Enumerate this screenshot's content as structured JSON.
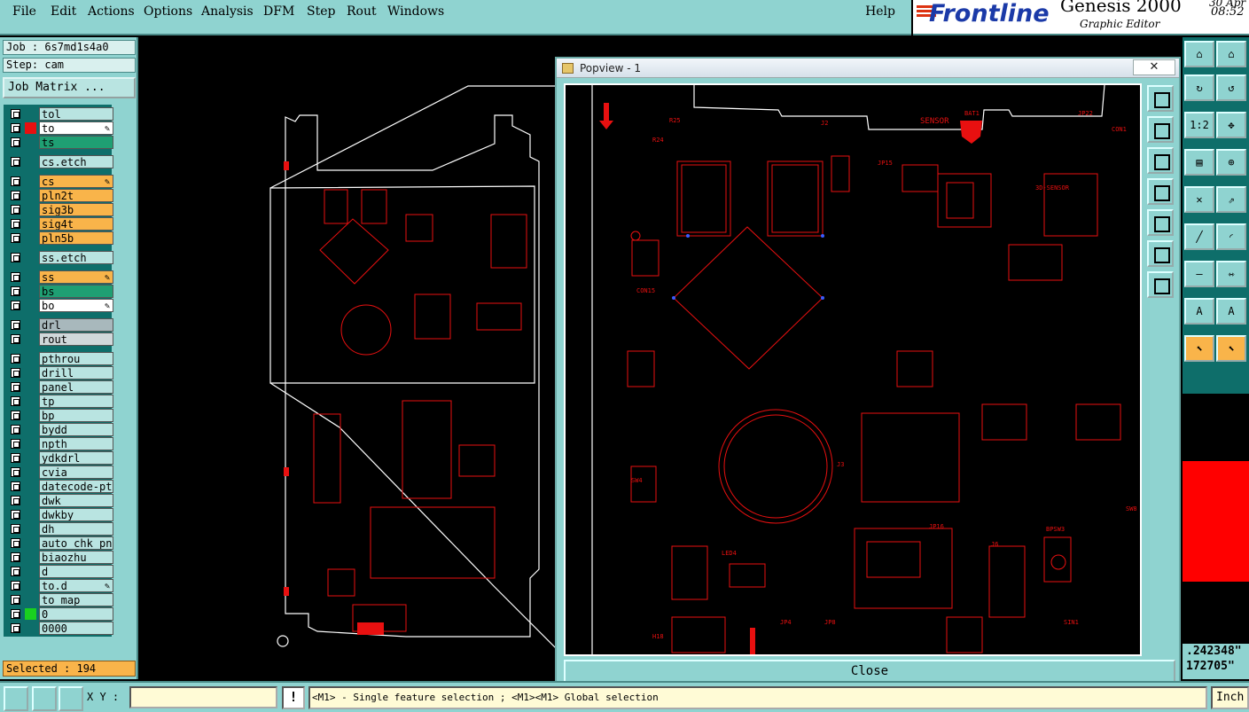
{
  "menu": {
    "items": [
      "File",
      "Edit",
      "Actions",
      "Options",
      "Analysis",
      "DFM",
      "Step",
      "Rout",
      "Windows"
    ],
    "help": "Help"
  },
  "brand": {
    "name": "Frontline",
    "product": "Genesis 2000",
    "subtitle": "Graphic Editor",
    "date": "30 Apr",
    "time": "08:52"
  },
  "job": {
    "job_label": "Job : 6s7md1s4a0",
    "step_label": "Step: cam",
    "matrix_button": "Job Matrix ..."
  },
  "layers": [
    {
      "name": "tol",
      "color": "#b9e4e1",
      "edit": false,
      "mark": ""
    },
    {
      "name": "to",
      "color": "#ffffff",
      "edit": true,
      "mark": "#e81010"
    },
    {
      "name": "ts",
      "color": "#1f9f73",
      "edit": false,
      "mark": ""
    },
    {
      "name": "cs.etch",
      "color": "#b9e4e1",
      "edit": false,
      "mark": ""
    },
    {
      "name": "cs",
      "color": "#f9b44a",
      "edit": true,
      "mark": ""
    },
    {
      "name": "pln2t",
      "color": "#f9b44a",
      "edit": false,
      "mark": ""
    },
    {
      "name": "sig3b",
      "color": "#f9b44a",
      "edit": false,
      "mark": ""
    },
    {
      "name": "sig4t",
      "color": "#f9b44a",
      "edit": false,
      "mark": ""
    },
    {
      "name": "pln5b",
      "color": "#f9b44a",
      "edit": false,
      "mark": ""
    },
    {
      "name": "ss.etch",
      "color": "#b9e4e1",
      "edit": false,
      "mark": ""
    },
    {
      "name": "ss",
      "color": "#f9b44a",
      "edit": true,
      "mark": ""
    },
    {
      "name": "bs",
      "color": "#1f9f73",
      "edit": false,
      "mark": ""
    },
    {
      "name": "bo",
      "color": "#ffffff",
      "edit": true,
      "mark": ""
    },
    {
      "name": "drl",
      "color": "#a8b8bc",
      "edit": false,
      "mark": ""
    },
    {
      "name": "rout",
      "color": "#d0d8da",
      "edit": false,
      "mark": ""
    },
    {
      "name": "pthrou",
      "color": "#b9e4e1",
      "edit": false,
      "mark": ""
    },
    {
      "name": "drill",
      "color": "#b9e4e1",
      "edit": false,
      "mark": ""
    },
    {
      "name": "panel",
      "color": "#b9e4e1",
      "edit": false,
      "mark": ""
    },
    {
      "name": "tp",
      "color": "#b9e4e1",
      "edit": false,
      "mark": ""
    },
    {
      "name": "bp",
      "color": "#b9e4e1",
      "edit": false,
      "mark": ""
    },
    {
      "name": "bydd",
      "color": "#b9e4e1",
      "edit": false,
      "mark": ""
    },
    {
      "name": "npth",
      "color": "#b9e4e1",
      "edit": false,
      "mark": ""
    },
    {
      "name": "ydkdrl",
      "color": "#b9e4e1",
      "edit": false,
      "mark": ""
    },
    {
      "name": "cvia",
      "color": "#b9e4e1",
      "edit": false,
      "mark": ""
    },
    {
      "name": "datecode-pte",
      "color": "#b9e4e1",
      "edit": false,
      "mark": ""
    },
    {
      "name": "dwk",
      "color": "#b9e4e1",
      "edit": false,
      "mark": ""
    },
    {
      "name": "dwkby",
      "color": "#b9e4e1",
      "edit": false,
      "mark": ""
    },
    {
      "name": "dh",
      "color": "#b9e4e1",
      "edit": false,
      "mark": ""
    },
    {
      "name": "auto_chk_pnl",
      "color": "#b9e4e1",
      "edit": false,
      "mark": ""
    },
    {
      "name": "biaozhu",
      "color": "#b9e4e1",
      "edit": false,
      "mark": ""
    },
    {
      "name": "d",
      "color": "#b9e4e1",
      "edit": false,
      "mark": ""
    },
    {
      "name": "to.d",
      "color": "#b9e4e1",
      "edit": true,
      "mark": ""
    },
    {
      "name": "to_map",
      "color": "#b9e4e1",
      "edit": false,
      "mark": ""
    },
    {
      "name": "0",
      "color": "#b9e4e1",
      "edit": false,
      "mark": "#19d01f"
    },
    {
      "name": "0000",
      "color": "#b9e4e1",
      "edit": false,
      "mark": ""
    }
  ],
  "selected_label": "Selected : 194",
  "popview": {
    "title": "Popview - 1",
    "close_x": "✕",
    "close_button": "Close",
    "labels": [
      "R25",
      "R24",
      "J2",
      "SENSOR",
      "BAT1",
      "JP22",
      "CON1",
      "JP15",
      "3D-SENSOR",
      "CON15",
      "J3",
      "SW4",
      "LED4",
      "JP16",
      "BPSW3",
      "JP4",
      "JP8",
      "H18",
      "SIN1",
      "SW8",
      "J6"
    ]
  },
  "coords": {
    "x": ".242348\"",
    "y": "172705\""
  },
  "right_tools": [
    "1:2"
  ],
  "bottom": {
    "xy_label": "X Y :",
    "xy_value": "",
    "warn": "!",
    "status": "<M1> - Single feature selection ; <M1><M1> Global selection",
    "units": "Inch"
  },
  "colors": {
    "panel": "#8fd3d0",
    "pcb_red": "#e81010",
    "highlight": "#f9b44a"
  }
}
